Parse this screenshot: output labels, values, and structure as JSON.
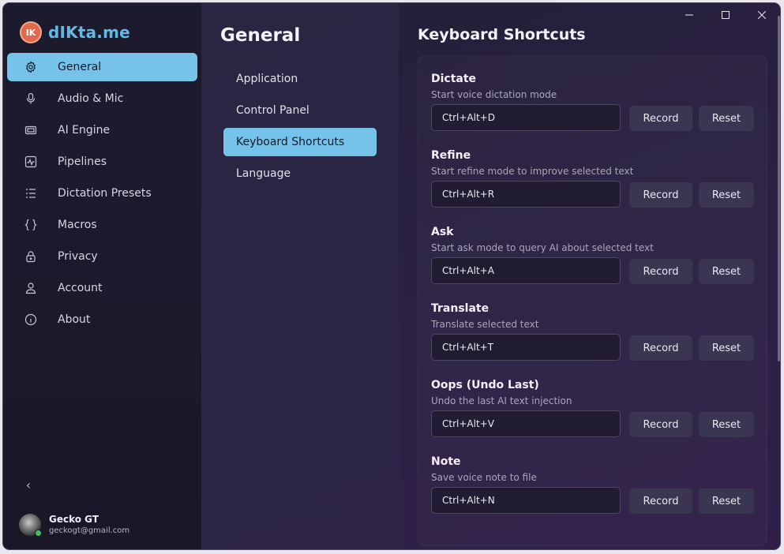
{
  "app": {
    "name": "dIKta.me",
    "logo_text": "IK"
  },
  "sidebar": {
    "items": [
      {
        "label": "General",
        "icon": "gear-icon",
        "active": true
      },
      {
        "label": "Audio & Mic",
        "icon": "microphone-icon",
        "active": false
      },
      {
        "label": "AI Engine",
        "icon": "chip-icon",
        "active": false
      },
      {
        "label": "Pipelines",
        "icon": "activity-icon",
        "active": false
      },
      {
        "label": "Dictation Presets",
        "icon": "list-icon",
        "active": false
      },
      {
        "label": "Macros",
        "icon": "braces-icon",
        "active": false
      },
      {
        "label": "Privacy",
        "icon": "lock-icon",
        "active": false
      },
      {
        "label": "Account",
        "icon": "user-icon",
        "active": false
      },
      {
        "label": "About",
        "icon": "info-icon",
        "active": false
      }
    ],
    "collapse_glyph": "‹",
    "user": {
      "name": "Gecko GT",
      "email": "geckogt@gmail.com",
      "status": "online"
    }
  },
  "middle": {
    "title": "General",
    "items": [
      {
        "label": "Application",
        "active": false
      },
      {
        "label": "Control Panel",
        "active": false
      },
      {
        "label": "Keyboard Shortcuts",
        "active": true
      },
      {
        "label": "Language",
        "active": false
      }
    ]
  },
  "main": {
    "title": "Keyboard Shortcuts",
    "shortcuts": [
      {
        "title": "Dictate",
        "description": "Start voice dictation mode",
        "value": "Ctrl+Alt+D",
        "record_label": "Record",
        "reset_label": "Reset"
      },
      {
        "title": "Refine",
        "description": "Start refine mode to improve selected text",
        "value": "Ctrl+Alt+R",
        "record_label": "Record",
        "reset_label": "Reset"
      },
      {
        "title": "Ask",
        "description": "Start ask mode to query AI about selected text",
        "value": "Ctrl+Alt+A",
        "record_label": "Record",
        "reset_label": "Reset"
      },
      {
        "title": "Translate",
        "description": "Translate selected text",
        "value": "Ctrl+Alt+T",
        "record_label": "Record",
        "reset_label": "Reset"
      },
      {
        "title": "Oops (Undo Last)",
        "description": "Undo the last AI text injection",
        "value": "Ctrl+Alt+V",
        "record_label": "Record",
        "reset_label": "Reset"
      },
      {
        "title": "Note",
        "description": "Save voice note to file",
        "value": "Ctrl+Alt+N",
        "record_label": "Record",
        "reset_label": "Reset"
      }
    ]
  },
  "colors": {
    "accent": "#76c3ea",
    "brand_orange": "#e06a4e",
    "brand_blue": "#62b9e8",
    "online": "#3fbf5f"
  }
}
